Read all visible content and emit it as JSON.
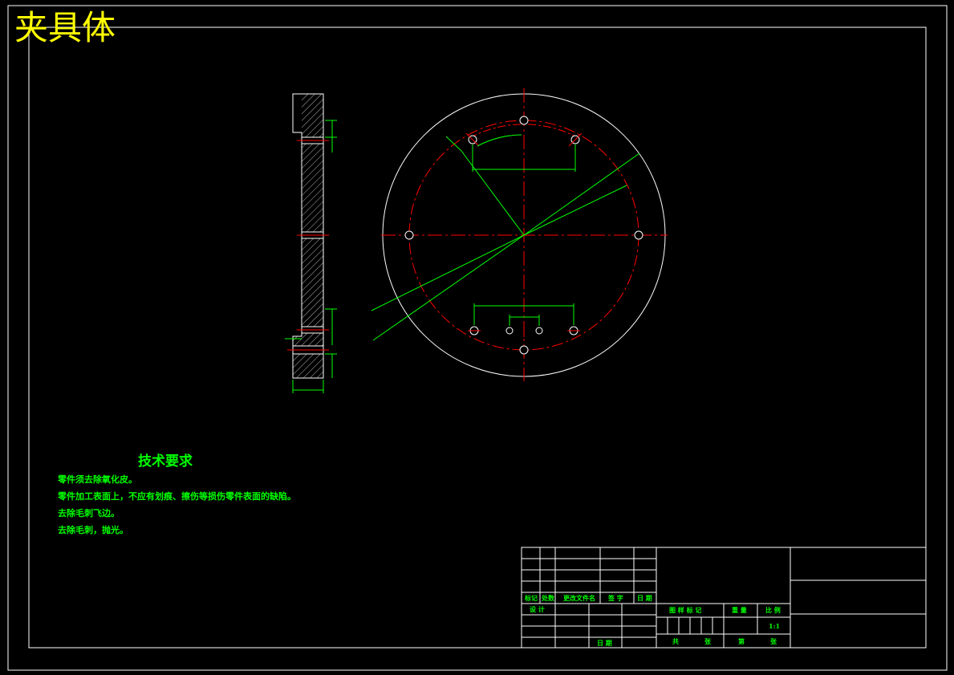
{
  "drawing": {
    "title": "夹具体",
    "tech_requirements": {
      "title": "技术要求",
      "items": [
        "零件须去除氧化皮。",
        "零件加工表面上，不应有划痕、擦伤等损伤零件表面的缺陷。",
        "去除毛刺飞边。",
        "去除毛刺，抛光。"
      ]
    },
    "title_block": {
      "mark": "标记",
      "count": "处数",
      "change_doc": "更改文件名",
      "signature": "签 字",
      "date": "日 期",
      "design": "设 计",
      "date2": "日 期",
      "drawing_mark": "图 样 标 记",
      "weight": "重 量",
      "scale_label": "比 例",
      "scale_value": "1:1",
      "total": "共",
      "sheet": "张",
      "page": "第",
      "sheet2": "张"
    },
    "colors": {
      "border": "#ffffff",
      "title": "#ffff00",
      "dimension": "#00ff00",
      "centerline": "#ff0000",
      "outline": "#ffffff"
    }
  }
}
